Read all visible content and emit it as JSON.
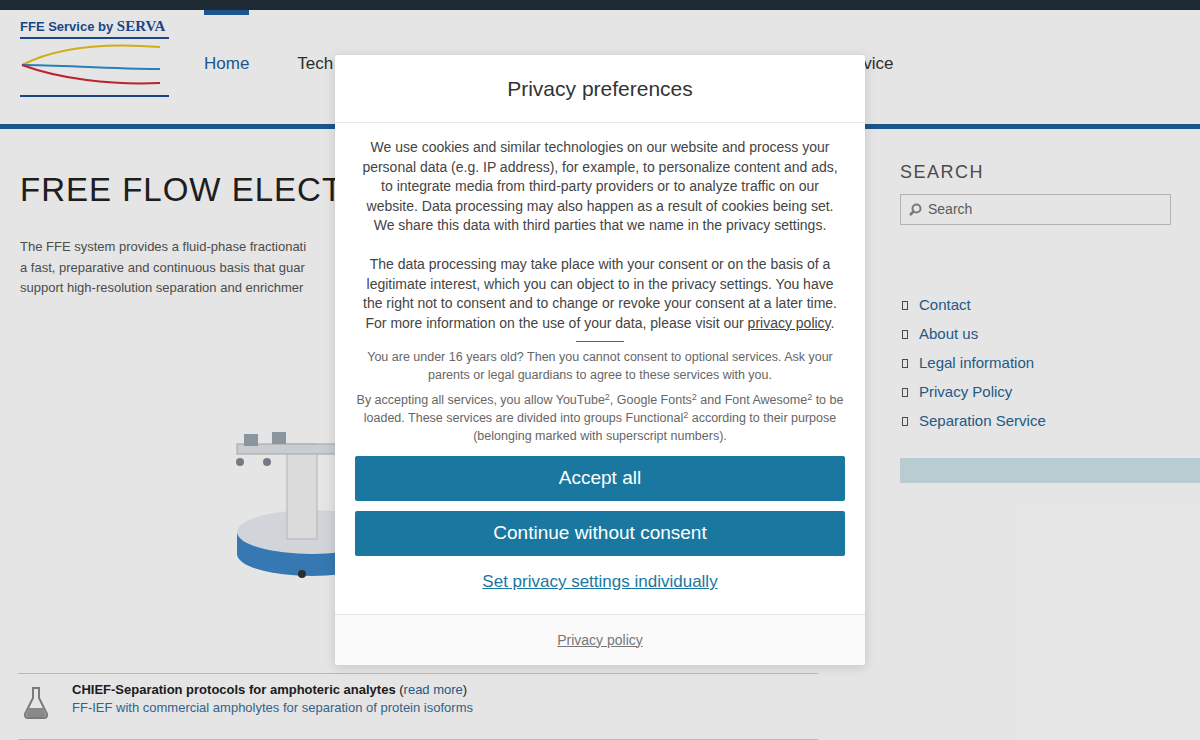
{
  "logo": {
    "prefix": "FFE Service by ",
    "brand": "SERVA"
  },
  "nav": [
    {
      "label": "Home",
      "selected": true
    },
    {
      "label": "Tech",
      "selected": false
    },
    {
      "label": "vice",
      "selected": false
    }
  ],
  "page": {
    "heading": "FREE FLOW ELECTRO",
    "intro_lines": [
      "The FFE system provides a fluid-phase fractionati",
      "a fast, preparative and continuous basis that guar",
      "support high-resolution separation and enrichmer"
    ]
  },
  "feature": {
    "title": "CHIEF-Separation protocols for amphoteric analytes",
    "link_open": " (",
    "link": "read more",
    "link_close": ")",
    "subtitle": "FF-IEF with commercial ampholytes for separation of protein isoforms"
  },
  "sidebar": {
    "search_title": "SEARCH",
    "search_placeholder": "Search",
    "links": [
      "Contact",
      "About us",
      "Legal information",
      "Privacy Policy",
      "Separation Service"
    ]
  },
  "dialog": {
    "title": "Privacy preferences",
    "paragraphs": [
      [
        {
          "kind": "text",
          "text": "We use cookies and similar technologies on our website and process your personal data (e.g. IP address), for example, to personalize content and ads, to integrate media from third-party providers or to analyze traffic on our website. Data processing may also happen as a result of cookies being set. We share this data with third parties that we name in the privacy settings."
        }
      ],
      [
        {
          "kind": "text",
          "text": "The data processing may take place with your consent or on the basis of a legitimate interest, which you can object to in the privacy settings. You have the right not to consent and to change or revoke your consent at a later time. For more information on the use of your data, please visit our "
        },
        {
          "kind": "link",
          "text": "privacy policy"
        },
        {
          "kind": "text",
          "text": "."
        }
      ]
    ],
    "age_notice": "You are under 16 years old? Then you cannot consent to optional services. Ask your parents or legal guardians to agree to these services with you.",
    "services_text": [
      {
        "kind": "text",
        "text": "By accepting all services, you allow YouTube"
      },
      {
        "kind": "sup",
        "text": "2"
      },
      {
        "kind": "text",
        "text": ", Google Fonts"
      },
      {
        "kind": "sup",
        "text": "2"
      },
      {
        "kind": "text",
        "text": " and Font Awesome"
      },
      {
        "kind": "sup",
        "text": "2"
      },
      {
        "kind": "text",
        "text": " to be loaded. These services are divided into groups Functional"
      },
      {
        "kind": "sup",
        "text": "2"
      },
      {
        "kind": "text",
        "text": " according to their purpose (belonging marked with superscript numbers)."
      }
    ],
    "buttons": [
      "Accept all",
      "Continue without consent"
    ],
    "individual_link": "Set privacy settings individually",
    "footer_link": "Privacy policy"
  }
}
